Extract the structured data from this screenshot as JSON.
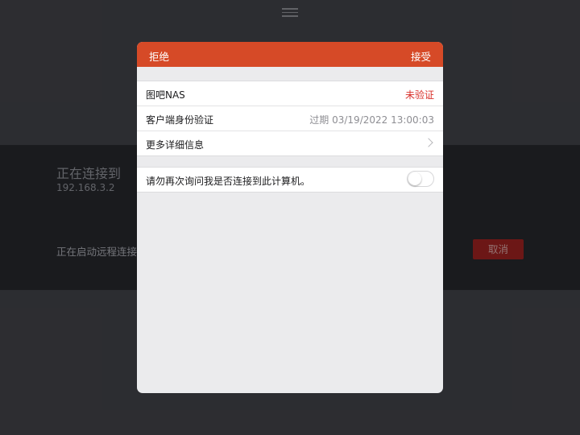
{
  "background": {
    "menu_icon": "hamburger-menu-icon",
    "title": "正在连接到",
    "ip": "192.168.3.2",
    "status": "正在启动远程连接",
    "cancel_label": "取消"
  },
  "dialog": {
    "reject_label": "拒绝",
    "accept_label": "接受",
    "accent_color": "#d64a27",
    "rows": [
      {
        "label": "图吧NAS",
        "value": "未验证"
      },
      {
        "label": "客户端身份验证",
        "value": "过期 03/19/2022 13:00:03"
      },
      {
        "label": "更多详细信息",
        "icon": "chevron-right-icon"
      }
    ],
    "toggle_row": {
      "label": "请勿再次询问我是否连接到此计算机。",
      "checked": false
    }
  }
}
